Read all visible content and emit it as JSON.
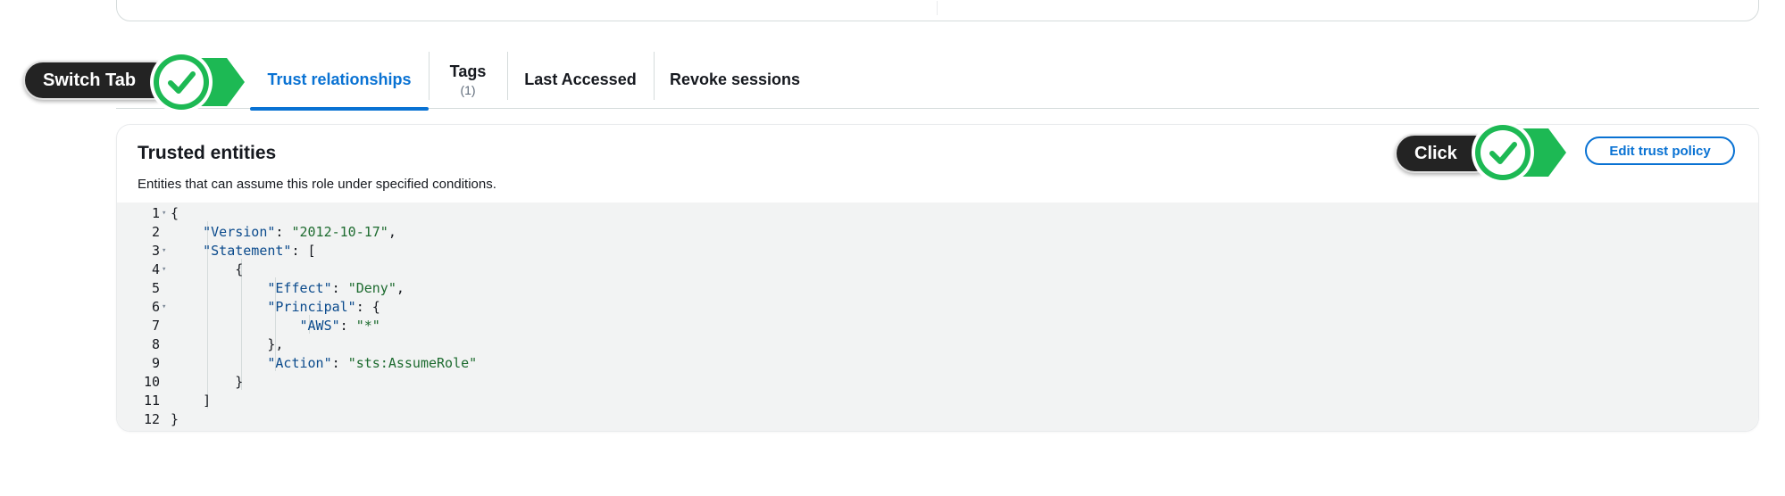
{
  "tabs": [
    {
      "label": "Trust relationships",
      "count": "",
      "active": true
    },
    {
      "label": "Tags",
      "count": "(1)",
      "active": false
    },
    {
      "label": "Last Accessed",
      "count": "",
      "active": false
    },
    {
      "label": "Revoke sessions",
      "count": "",
      "active": false
    }
  ],
  "card": {
    "title": "Trusted entities",
    "description": "Entities that can assume this role under specified conditions.",
    "edit_button_label": "Edit trust policy"
  },
  "policy_lines": [
    "{",
    "    \"Version\": \"2012-10-17\",",
    "    \"Statement\": [",
    "        {",
    "            \"Effect\": \"Deny\",",
    "            \"Principal\": {",
    "                \"AWS\": \"*\"",
    "            },",
    "            \"Action\": \"sts:AssumeRole\"",
    "        }",
    "    ]",
    "}"
  ],
  "line_numbers": [
    "1",
    "2",
    "3",
    "4",
    "5",
    "6",
    "7",
    "8",
    "9",
    "10",
    "11",
    "12"
  ],
  "annotations": {
    "switch_tab_label": "Switch Tab",
    "click_label": "Click"
  },
  "colors": {
    "accent": "#0972d3",
    "badge_green": "#1db954",
    "label_bg": "#232323"
  },
  "icons": {
    "check": "check-icon",
    "fold": "fold-arrow-icon"
  }
}
